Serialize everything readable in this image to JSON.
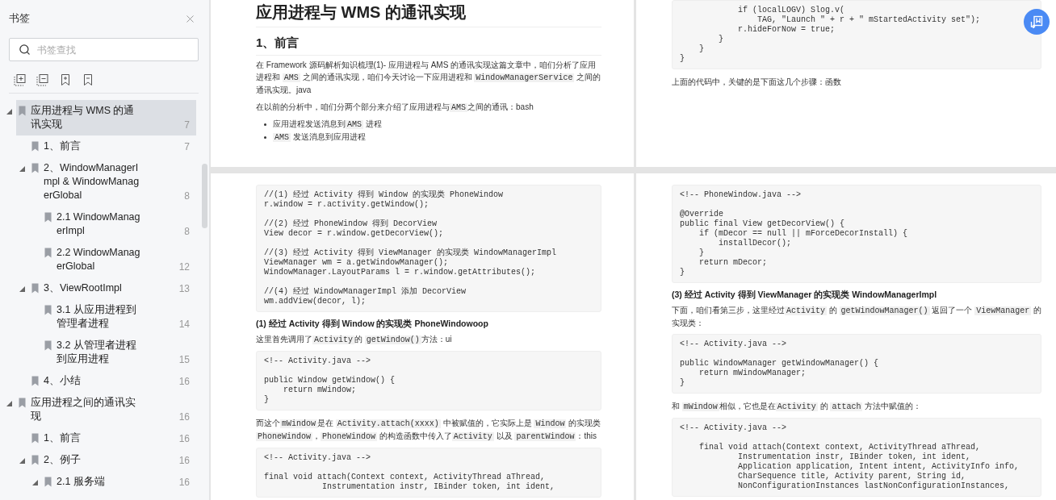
{
  "sidebar": {
    "title": "书签",
    "search": {
      "placeholder": "书签查找"
    },
    "tree": [
      {
        "title": "应用进程与 WMS 的通讯实现",
        "page": "7",
        "selected": true,
        "expanded": true,
        "children": [
          {
            "title": "1、前言",
            "page": "7",
            "selected": false
          },
          {
            "title": "2、WindowManagerImpl & WindowManagerGlobal",
            "page": "8",
            "selected": false,
            "expanded": true,
            "children": [
              {
                "title": "2.1 WindowManagerImpl",
                "page": "8",
                "selected": false
              },
              {
                "title": "2.2 WindowManagerGlobal",
                "page": "12",
                "selected": false
              }
            ]
          },
          {
            "title": "3、ViewRootImpl",
            "page": "13",
            "selected": false,
            "expanded": true,
            "children": [
              {
                "title": "3.1 从应用进程到管理者进程",
                "page": "14",
                "selected": false
              },
              {
                "title": "3.2 从管理者进程到应用进程",
                "page": "15",
                "selected": false
              }
            ]
          },
          {
            "title": "4、小结",
            "page": "16",
            "selected": false
          }
        ]
      },
      {
        "title": "应用进程之间的通讯实现",
        "page": "16",
        "selected": false,
        "expanded": true,
        "children": [
          {
            "title": "1、前言",
            "page": "16",
            "selected": false
          },
          {
            "title": "2、例子",
            "page": "16",
            "selected": false,
            "expanded": true,
            "children": [
              {
                "title": "2.1 服务端",
                "page": "16",
                "selected": false,
                "expanded": true
              }
            ]
          }
        ]
      }
    ]
  },
  "pages": [
    {
      "blocks": [
        {
          "kind": "h1",
          "text": "应用进程与 WMS 的通讯实现"
        },
        {
          "kind": "h2",
          "text": "1、前言"
        },
        {
          "kind": "p",
          "segments": [
            {
              "text": "在 Framework 源码解析知识梳理(1)- 应用进程与 AMS 的通讯实现这篇文章中，咱们分析了应用进程和 ",
              "code": false
            },
            {
              "text": "AMS",
              "code": true
            },
            {
              "text": " 之间的通讯实现，咱们今天讨论一下应用进程和 ",
              "code": false
            },
            {
              "text": "WindowManagerService",
              "code": true
            },
            {
              "text": " 之间的通讯实现。java",
              "code": false
            }
          ]
        },
        {
          "kind": "p",
          "segments": [
            {
              "text": "在以前的分析中，咱们分两个部分来介绍了应用进程与",
              "code": false
            },
            {
              "text": "AMS",
              "code": true
            },
            {
              "text": "之间的通讯：bash",
              "code": false
            }
          ]
        },
        {
          "kind": "ul",
          "items": [
            {
              "segments": [
                {
                  "text": "应用进程发送消息到",
                  "code": false
                },
                {
                  "text": "AMS",
                  "code": true
                },
                {
                  "text": " 进程",
                  "code": false
                }
              ]
            },
            {
              "segments": [
                {
                  "text": "AMS",
                  "code": true
                },
                {
                  "text": " 发送消息到应用进程",
                  "code": false
                }
              ]
            }
          ]
        }
      ]
    },
    {
      "blocks": [
        {
          "kind": "code",
          "groups": [
            [
              "            if (localLOGV) Slog.v(",
              "                TAG, \"Launch \" + r + \" mStartedActivity set\");",
              "            r.hideForNow = true;",
              "        }",
              "    }",
              "}"
            ]
          ]
        },
        {
          "kind": "p",
          "segments": [
            {
              "text": "上面的代码中，关键的是下面这几个步骤：函数",
              "code": false
            }
          ]
        }
      ]
    },
    {
      "blocks": [
        {
          "kind": "code",
          "groups": [
            [
              "//(1) 经过 Activity 得到 Window 的实现类 PhoneWindow",
              "r.window = r.activity.getWindow();"
            ],
            [
              "//(2) 经过 PhoneWindow 得到 DecorView",
              "View decor = r.window.getDecorView();"
            ],
            [
              "//(3) 经过 Activity 得到 ViewManager 的实现类 WindowManagerImpl",
              "ViewManager wm = a.getWindowManager();",
              "WindowManager.LayoutParams l = r.window.getAttributes();"
            ],
            [
              "//(4) 经过 WindowManagerImpl 添加 DecorView",
              "wm.addView(decor, l);"
            ]
          ]
        },
        {
          "kind": "h4",
          "text": "(1) 经过 Activity 得到 Window 的实现类 PhoneWindowoop"
        },
        {
          "kind": "p",
          "segments": [
            {
              "text": "这里首先调用了",
              "code": false
            },
            {
              "text": "Activity",
              "code": true
            },
            {
              "text": "的 ",
              "code": false
            },
            {
              "text": "getWindow()",
              "code": true
            },
            {
              "text": "方法：ui",
              "code": false
            }
          ]
        },
        {
          "kind": "code",
          "groups": [
            [
              "<!-- Activity.java -->"
            ],
            [
              "public Window getWindow() {",
              "    return mWindow;",
              "}"
            ]
          ]
        },
        {
          "kind": "p",
          "segments": [
            {
              "text": "而这个",
              "code": false
            },
            {
              "text": "mWindow",
              "code": true
            },
            {
              "text": "是在 ",
              "code": false
            },
            {
              "text": "Activity.attach(xxxx)",
              "code": true
            },
            {
              "text": " 中被赋值的，它实际上是 ",
              "code": false
            },
            {
              "text": "Window",
              "code": true
            },
            {
              "text": " 的实现类 ",
              "code": false
            },
            {
              "text": "PhoneWindow",
              "code": true
            },
            {
              "text": "，",
              "code": false
            },
            {
              "text": "PhoneWindow",
              "code": true
            },
            {
              "text": " 的构造函数中传入了",
              "code": false
            },
            {
              "text": "Activity",
              "code": true
            },
            {
              "text": " 以及 ",
              "code": false
            },
            {
              "text": "parentWindow",
              "code": true
            },
            {
              "text": "：this",
              "code": false
            }
          ]
        },
        {
          "kind": "code",
          "groups": [
            [
              "<!-- Activity.java -->"
            ],
            [
              "final void attach(Context context, ActivityThread aThread,",
              "            Instrumentation instr, IBinder token, int ident,"
            ]
          ]
        }
      ]
    },
    {
      "blocks": [
        {
          "kind": "code",
          "groups": [
            [
              "<!-- PhoneWindow.java -->"
            ],
            [
              "@Override",
              "public final View getDecorView() {",
              "    if (mDecor == null || mForceDecorInstall) {",
              "        installDecor();",
              "    }",
              "    return mDecor;",
              "}"
            ]
          ]
        },
        {
          "kind": "h4",
          "text": "(3) 经过 Activity 得到 ViewManager 的实现类 WindowManagerImpl"
        },
        {
          "kind": "p",
          "segments": [
            {
              "text": "下面，咱们看第三步，这里经过",
              "code": false
            },
            {
              "text": "Activity",
              "code": true
            },
            {
              "text": " 的 ",
              "code": false
            },
            {
              "text": "getWindowManager()",
              "code": true
            },
            {
              "text": " 返回了一个 ",
              "code": false
            },
            {
              "text": "ViewManager",
              "code": true
            },
            {
              "text": " 的实现类：",
              "code": false
            }
          ]
        },
        {
          "kind": "code",
          "groups": [
            [
              "<!-- Activity.java -->"
            ],
            [
              "public WindowManager getWindowManager() {",
              "    return mWindowManager;",
              "}"
            ]
          ]
        },
        {
          "kind": "p",
          "segments": [
            {
              "text": "和 ",
              "code": false
            },
            {
              "text": "mWindow",
              "code": true
            },
            {
              "text": "相似，它也是在",
              "code": false
            },
            {
              "text": "Activity",
              "code": true
            },
            {
              "text": " 的 ",
              "code": false
            },
            {
              "text": "attach",
              "code": true
            },
            {
              "text": " 方法中赋值的：",
              "code": false
            }
          ]
        },
        {
          "kind": "code",
          "groups": [
            [
              "<!-- Activity.java -->"
            ],
            [
              "    final void attach(Context context, ActivityThread aThread,",
              "            Instrumentation instr, IBinder token, int ident,",
              "            Application application, Intent intent, ActivityInfo info,",
              "            CharSequence title, Activity parent, String id,",
              "            NonConfigurationInstances lastNonConfigurationInstances,"
            ]
          ]
        }
      ]
    }
  ]
}
